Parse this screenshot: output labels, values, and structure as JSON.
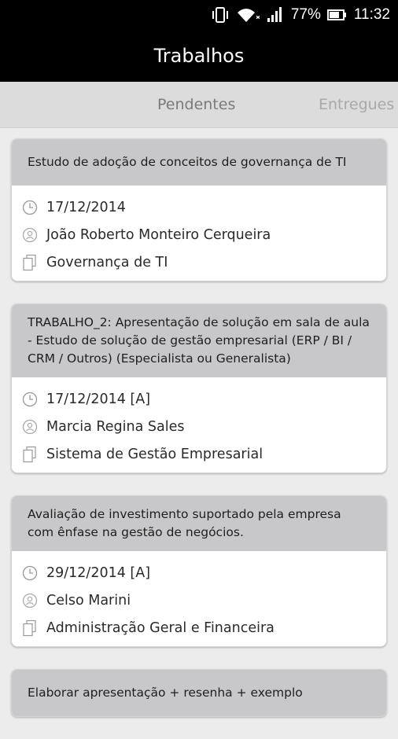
{
  "status_bar": {
    "battery_percent": "77%",
    "time": "11:32",
    "icons": [
      "vibrate-icon",
      "wifi-icon",
      "signal-icon",
      "battery-icon"
    ]
  },
  "app_bar": {
    "title": "Trabalhos"
  },
  "tabs": [
    {
      "label": "Pendentes",
      "selected": true
    },
    {
      "label": "Entregues",
      "selected": false
    }
  ],
  "cards": [
    {
      "title": "Estudo de adoção de conceitos de governança de TI",
      "date": "17/12/2014",
      "person": "João Roberto Monteiro Cerqueira",
      "course": "Governança de TI"
    },
    {
      "title": "TRABALHO_2: Apresentação de solução em sala de aula - Estudo de solução de gestão empresarial (ERP / BI / CRM / Outros) (Especialista ou Generalista)",
      "date": "17/12/2014 [A]",
      "person": "Marcia Regina Sales",
      "course": "Sistema de Gestão Empresarial"
    },
    {
      "title": "Avaliação de investimento suportado pela empresa com ênfase na gestão de negócios.",
      "date": "29/12/2014 [A]",
      "person": "Celso Marini",
      "course": "Administração Geral e Financeira"
    },
    {
      "title": "Elaborar apresentação + resenha + exemplo",
      "date": "",
      "person": "",
      "course": ""
    }
  ],
  "colors": {
    "status_bar_bg": "#000000",
    "app_bar_bg": "#000000",
    "tabs_bg": "#dcdcdc",
    "card_header_bg": "#c8c8ca",
    "page_bg": "#ececec"
  }
}
